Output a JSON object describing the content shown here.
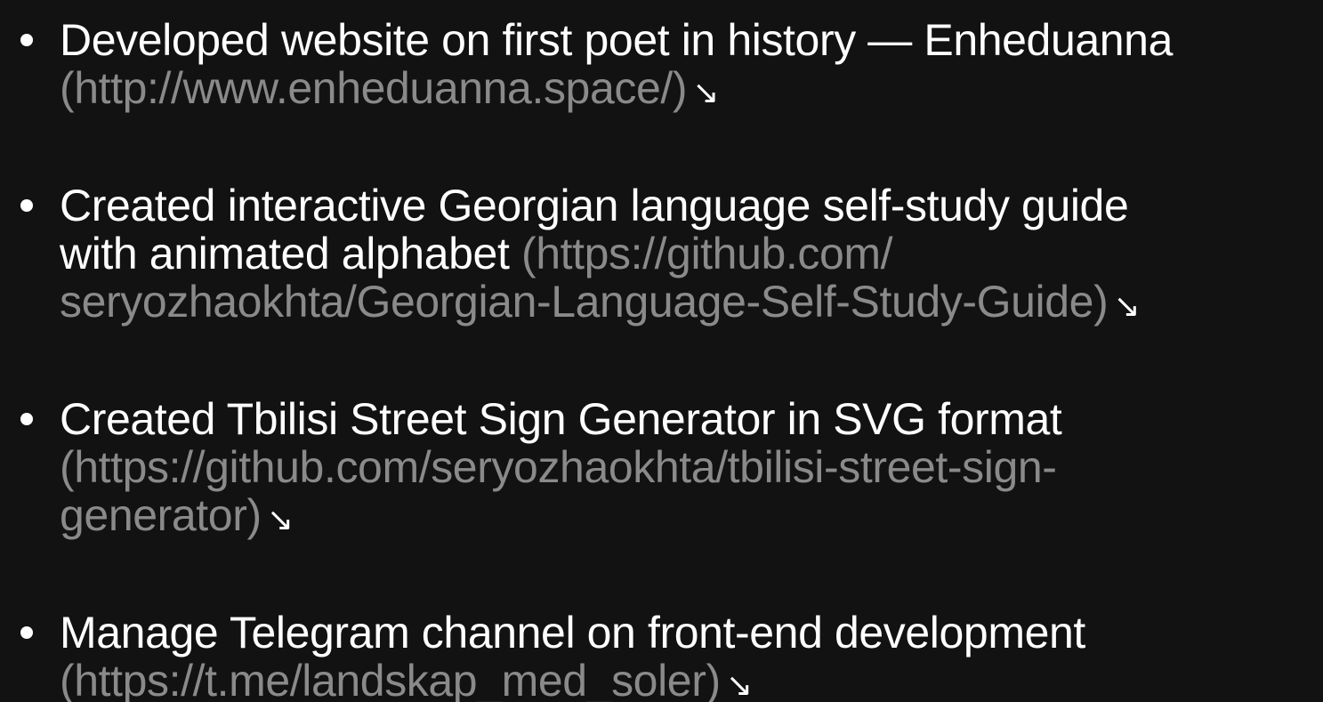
{
  "projects": [
    {
      "text": "Developed website on first poet in history — Enheduanna",
      "link": "(http://www.enheduanna.space/)",
      "arrow": "↘"
    },
    {
      "text": "Created interactive Georgian language self-study guide",
      "text_line2": "with animated alphabet",
      "link_line2": "(https://github.com/",
      "link_line3": "seryozhaokhta/Georgian-Language-Self-Study-Guide)",
      "arrow": "↘"
    },
    {
      "text": "Created Tbilisi Street Sign Generator in SVG format",
      "link_line2": "(https://github.com/seryozhaokhta/tbilisi-street-sign-",
      "link_line3": "generator)",
      "arrow": "↘"
    },
    {
      "text": "Manage Telegram channel on front-end development",
      "link": "(https://t.me/landskap_med_soler)",
      "arrow": "↘"
    }
  ]
}
